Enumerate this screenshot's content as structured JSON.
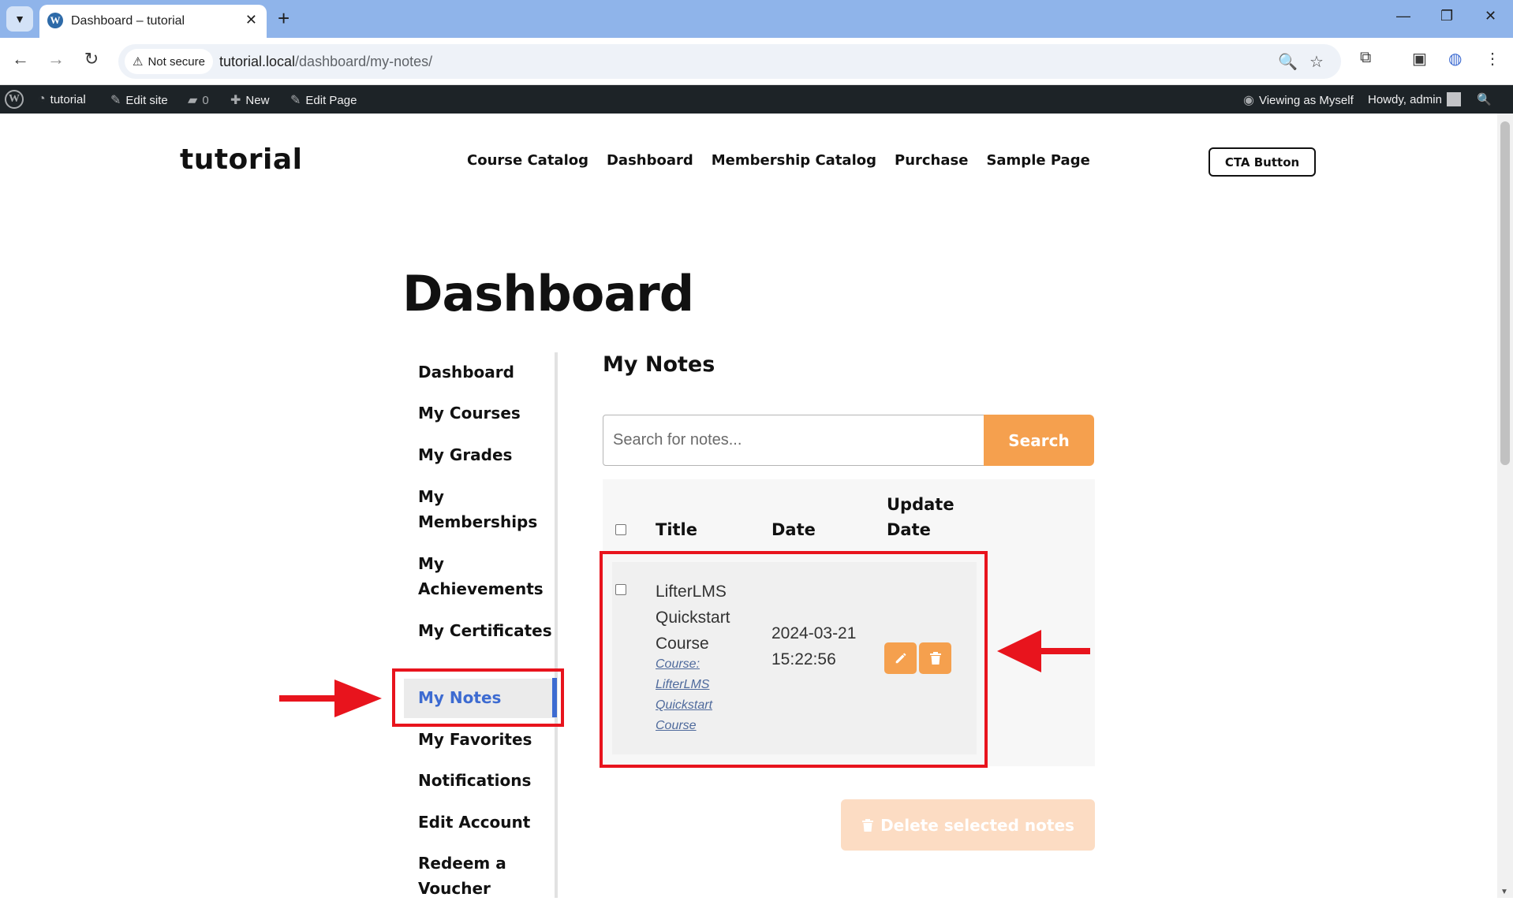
{
  "browser": {
    "tab_title": "Dashboard – tutorial",
    "security_label": "Not secure",
    "url_host": "tutorial.local",
    "url_path": "/dashboard/my-notes/"
  },
  "admin_bar": {
    "site_name": "tutorial",
    "edit_site": "Edit site",
    "comments_count": "0",
    "new_label": "New",
    "edit_page": "Edit Page",
    "viewing_as": "Viewing as Myself",
    "howdy": "Howdy, admin"
  },
  "site": {
    "title": "tutorial",
    "nav": [
      "Course Catalog",
      "Dashboard",
      "Membership Catalog",
      "Purchase",
      "Sample Page"
    ],
    "cta": "CTA Button"
  },
  "page": {
    "title": "Dashboard"
  },
  "sidebar": {
    "items": [
      {
        "label": "Dashboard"
      },
      {
        "label": "My Courses"
      },
      {
        "label": "My Grades"
      },
      {
        "label": "My Memberships"
      },
      {
        "label": "My Achievements"
      },
      {
        "label": "My Certificates"
      },
      {
        "label": "My Notes",
        "active": true
      },
      {
        "label": "My Favorites"
      },
      {
        "label": "Notifications"
      },
      {
        "label": "Edit Account"
      },
      {
        "label": "Redeem a Voucher"
      }
    ]
  },
  "notes": {
    "heading": "My Notes",
    "search_placeholder": "Search for notes...",
    "search_button": "Search",
    "columns": [
      "Title",
      "Date",
      "Update Date"
    ],
    "rows": [
      {
        "title": "LifterLMS Quickstart Course",
        "link": "Course: LifterLMS Quickstart Course",
        "date": "2024-03-21 15:22:56",
        "update_date": ""
      }
    ],
    "delete_selected": "Delete selected notes"
  },
  "colors": {
    "accent": "#f5a04e",
    "active_nav": "#3d6bd1",
    "annotation": "#e8141d",
    "admin_bar": "#1d2327"
  },
  "icons": [
    "wordpress-icon",
    "edit-site-icon",
    "comment-icon",
    "plus-icon",
    "pencil-icon",
    "trash-icon",
    "search-icon",
    "star-icon",
    "extensions-icon",
    "sidebar-icon"
  ]
}
